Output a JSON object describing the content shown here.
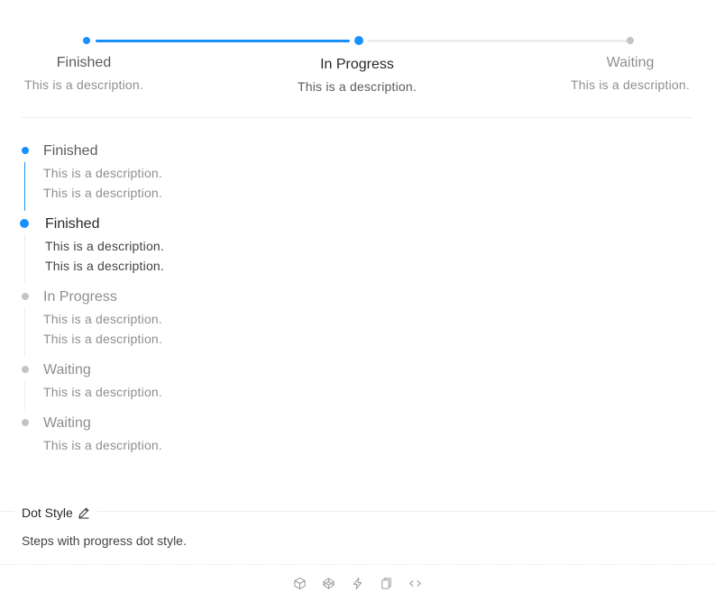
{
  "colors": {
    "primary": "#1890ff",
    "waiting": "#c4c4c4",
    "line_waiting": "#eeeeee",
    "title_active": "rgba(0,0,0,0.85)",
    "text_muted": "rgba(0,0,0,0.45)"
  },
  "horizontal_steps": [
    {
      "title": "Finished",
      "description": "This is a description.",
      "status": "finished"
    },
    {
      "title": "In Progress",
      "description": "This is a description.",
      "status": "process"
    },
    {
      "title": "Waiting",
      "description": "This is a description.",
      "status": "wait"
    }
  ],
  "vertical_steps": [
    {
      "title": "Finished",
      "descriptions": [
        "This is a description.",
        "This is a description."
      ],
      "status": "finished"
    },
    {
      "title": "Finished",
      "descriptions": [
        "This is a description.",
        "This is a description."
      ],
      "status": "process"
    },
    {
      "title": "In Progress",
      "descriptions": [
        "This is a description.",
        "This is a description."
      ],
      "status": "wait"
    },
    {
      "title": "Waiting",
      "descriptions": [
        "This is a description."
      ],
      "status": "wait"
    },
    {
      "title": "Waiting",
      "descriptions": [
        "This is a description."
      ],
      "status": "wait"
    }
  ],
  "meta": {
    "title": "Dot Style",
    "description": "Steps with progress dot style."
  },
  "actions": [
    "codesandbox-icon",
    "codepen-icon",
    "stackblitz-icon",
    "copy-icon",
    "code-icon"
  ]
}
